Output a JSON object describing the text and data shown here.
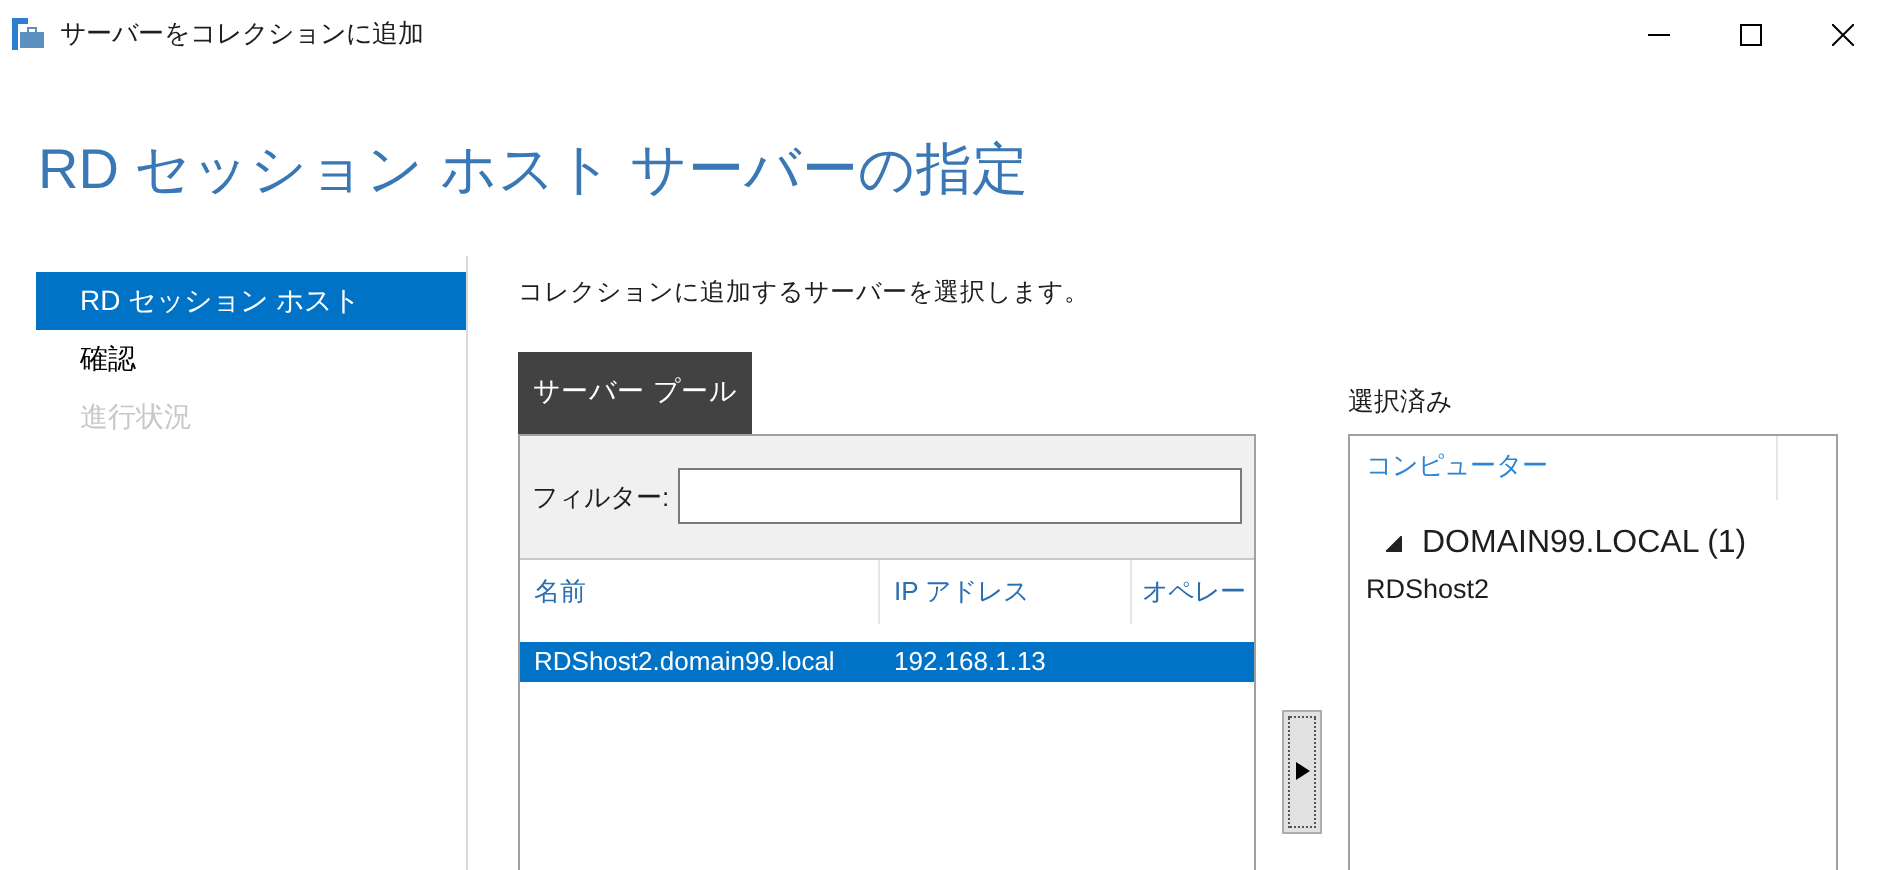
{
  "window": {
    "title": "サーバーをコレクションに追加"
  },
  "page_title": "RD セッション ホスト サーバーの指定",
  "steps": [
    {
      "label": "RD セッション ホスト",
      "selected": true,
      "disabled": false
    },
    {
      "label": "確認",
      "selected": false,
      "disabled": false
    },
    {
      "label": "進行状況",
      "selected": false,
      "disabled": true
    }
  ],
  "instruction": "コレクションに追加するサーバーを選択します。",
  "server_pool": {
    "tab": "サーバー プール",
    "filter": {
      "label": "フィルター:"
    },
    "columns": [
      "名前",
      "IP アドレス",
      "オペレー"
    ],
    "rows": [
      {
        "cells": [
          "RDShost2.domain99.local",
          "192.168.1.13"
        ],
        "selected": true
      }
    ]
  },
  "selected_list": {
    "label": "選択済み",
    "column": "コンピューター",
    "groups": [
      {
        "label": "DOMAIN99.LOCAL (1)",
        "expanded": true,
        "children": [
          {
            "label": "RDShost2"
          }
        ]
      }
    ]
  }
}
